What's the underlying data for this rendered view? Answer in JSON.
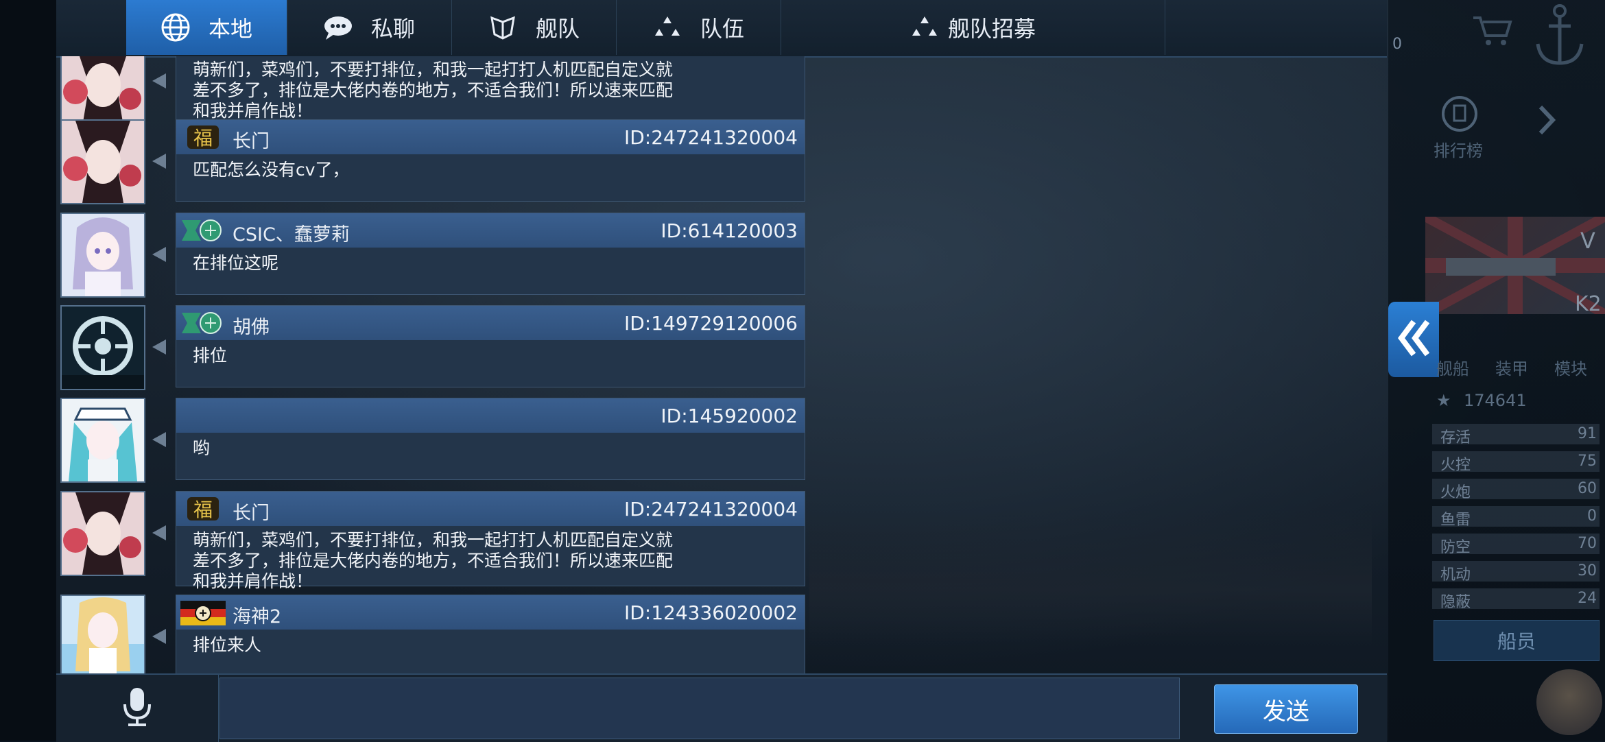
{
  "tabs": [
    {
      "label": "本地",
      "icon": "globe-icon",
      "active": true
    },
    {
      "label": "私聊",
      "icon": "chat-bubble-icon",
      "active": false
    },
    {
      "label": "舰队",
      "icon": "fleet-icon",
      "active": false
    },
    {
      "label": "队伍",
      "icon": "team-icon",
      "active": false
    },
    {
      "label": "舰队招募",
      "icon": "team-icon",
      "active": false
    }
  ],
  "messages": [
    {
      "avatar": "anime-catgirl",
      "badge": "",
      "name": "",
      "id": "",
      "text": "萌新们，菜鸡们，不要打排位，和我一起打打人机匹配自定义就\n差不多了，排位是大佬内卷的地方，不适合我们！所以速来匹配\n和我并肩作战！"
    },
    {
      "avatar": "anime-catgirl",
      "badge": "fu-badge",
      "name": "长门",
      "id": "ID:247241320004",
      "text": "匹配怎么没有cv了，"
    },
    {
      "avatar": "anime-maid",
      "badge": "green-emblem-badge",
      "name": "CSIC、蠢萝莉",
      "id": "ID:614120003",
      "text": "在排位这呢"
    },
    {
      "avatar": "crosshair-logo",
      "badge": "green-emblem-badge",
      "name": "胡佛",
      "id": "ID:149729120006",
      "text": "排位"
    },
    {
      "avatar": "anime-miku",
      "badge": "",
      "name": "",
      "id": "ID:145920002",
      "text": "哟"
    },
    {
      "avatar": "anime-catgirl",
      "badge": "fu-badge",
      "name": "长门",
      "id": "ID:247241320004",
      "text": "萌新们，菜鸡们，不要打排位，和我一起打打人机匹配自定义就\n差不多了，排位是大佬内卷的地方，不适合我们！所以速来匹配\n和我并肩作战！"
    },
    {
      "avatar": "anime-blonde",
      "badge": "german-flag-badge",
      "name": "海神2",
      "id": "ID:124336020002",
      "text": "排位来人"
    }
  ],
  "input": {
    "placeholder": "",
    "send_label": "发送",
    "mic_icon": "microphone-icon"
  },
  "right_panel": {
    "top_count": "0",
    "rank_label": "排行榜",
    "ship_label_v": "V",
    "ship_label_k": "K2",
    "tabs": [
      "舰船",
      "装甲",
      "模块"
    ],
    "score": "174641",
    "stats": [
      {
        "label": "存活",
        "value": "91"
      },
      {
        "label": "火控",
        "value": "75"
      },
      {
        "label": "火炮",
        "value": "60"
      },
      {
        "label": "鱼雷",
        "value": "0"
      },
      {
        "label": "防空",
        "value": "70"
      },
      {
        "label": "机动",
        "value": "30"
      },
      {
        "label": "隐蔽",
        "value": "24"
      }
    ],
    "crew_label": "船员"
  },
  "colors": {
    "accent": "#2c7bd1",
    "bubble_head": "#3a5f8f",
    "bubble_body": "#23354a"
  }
}
